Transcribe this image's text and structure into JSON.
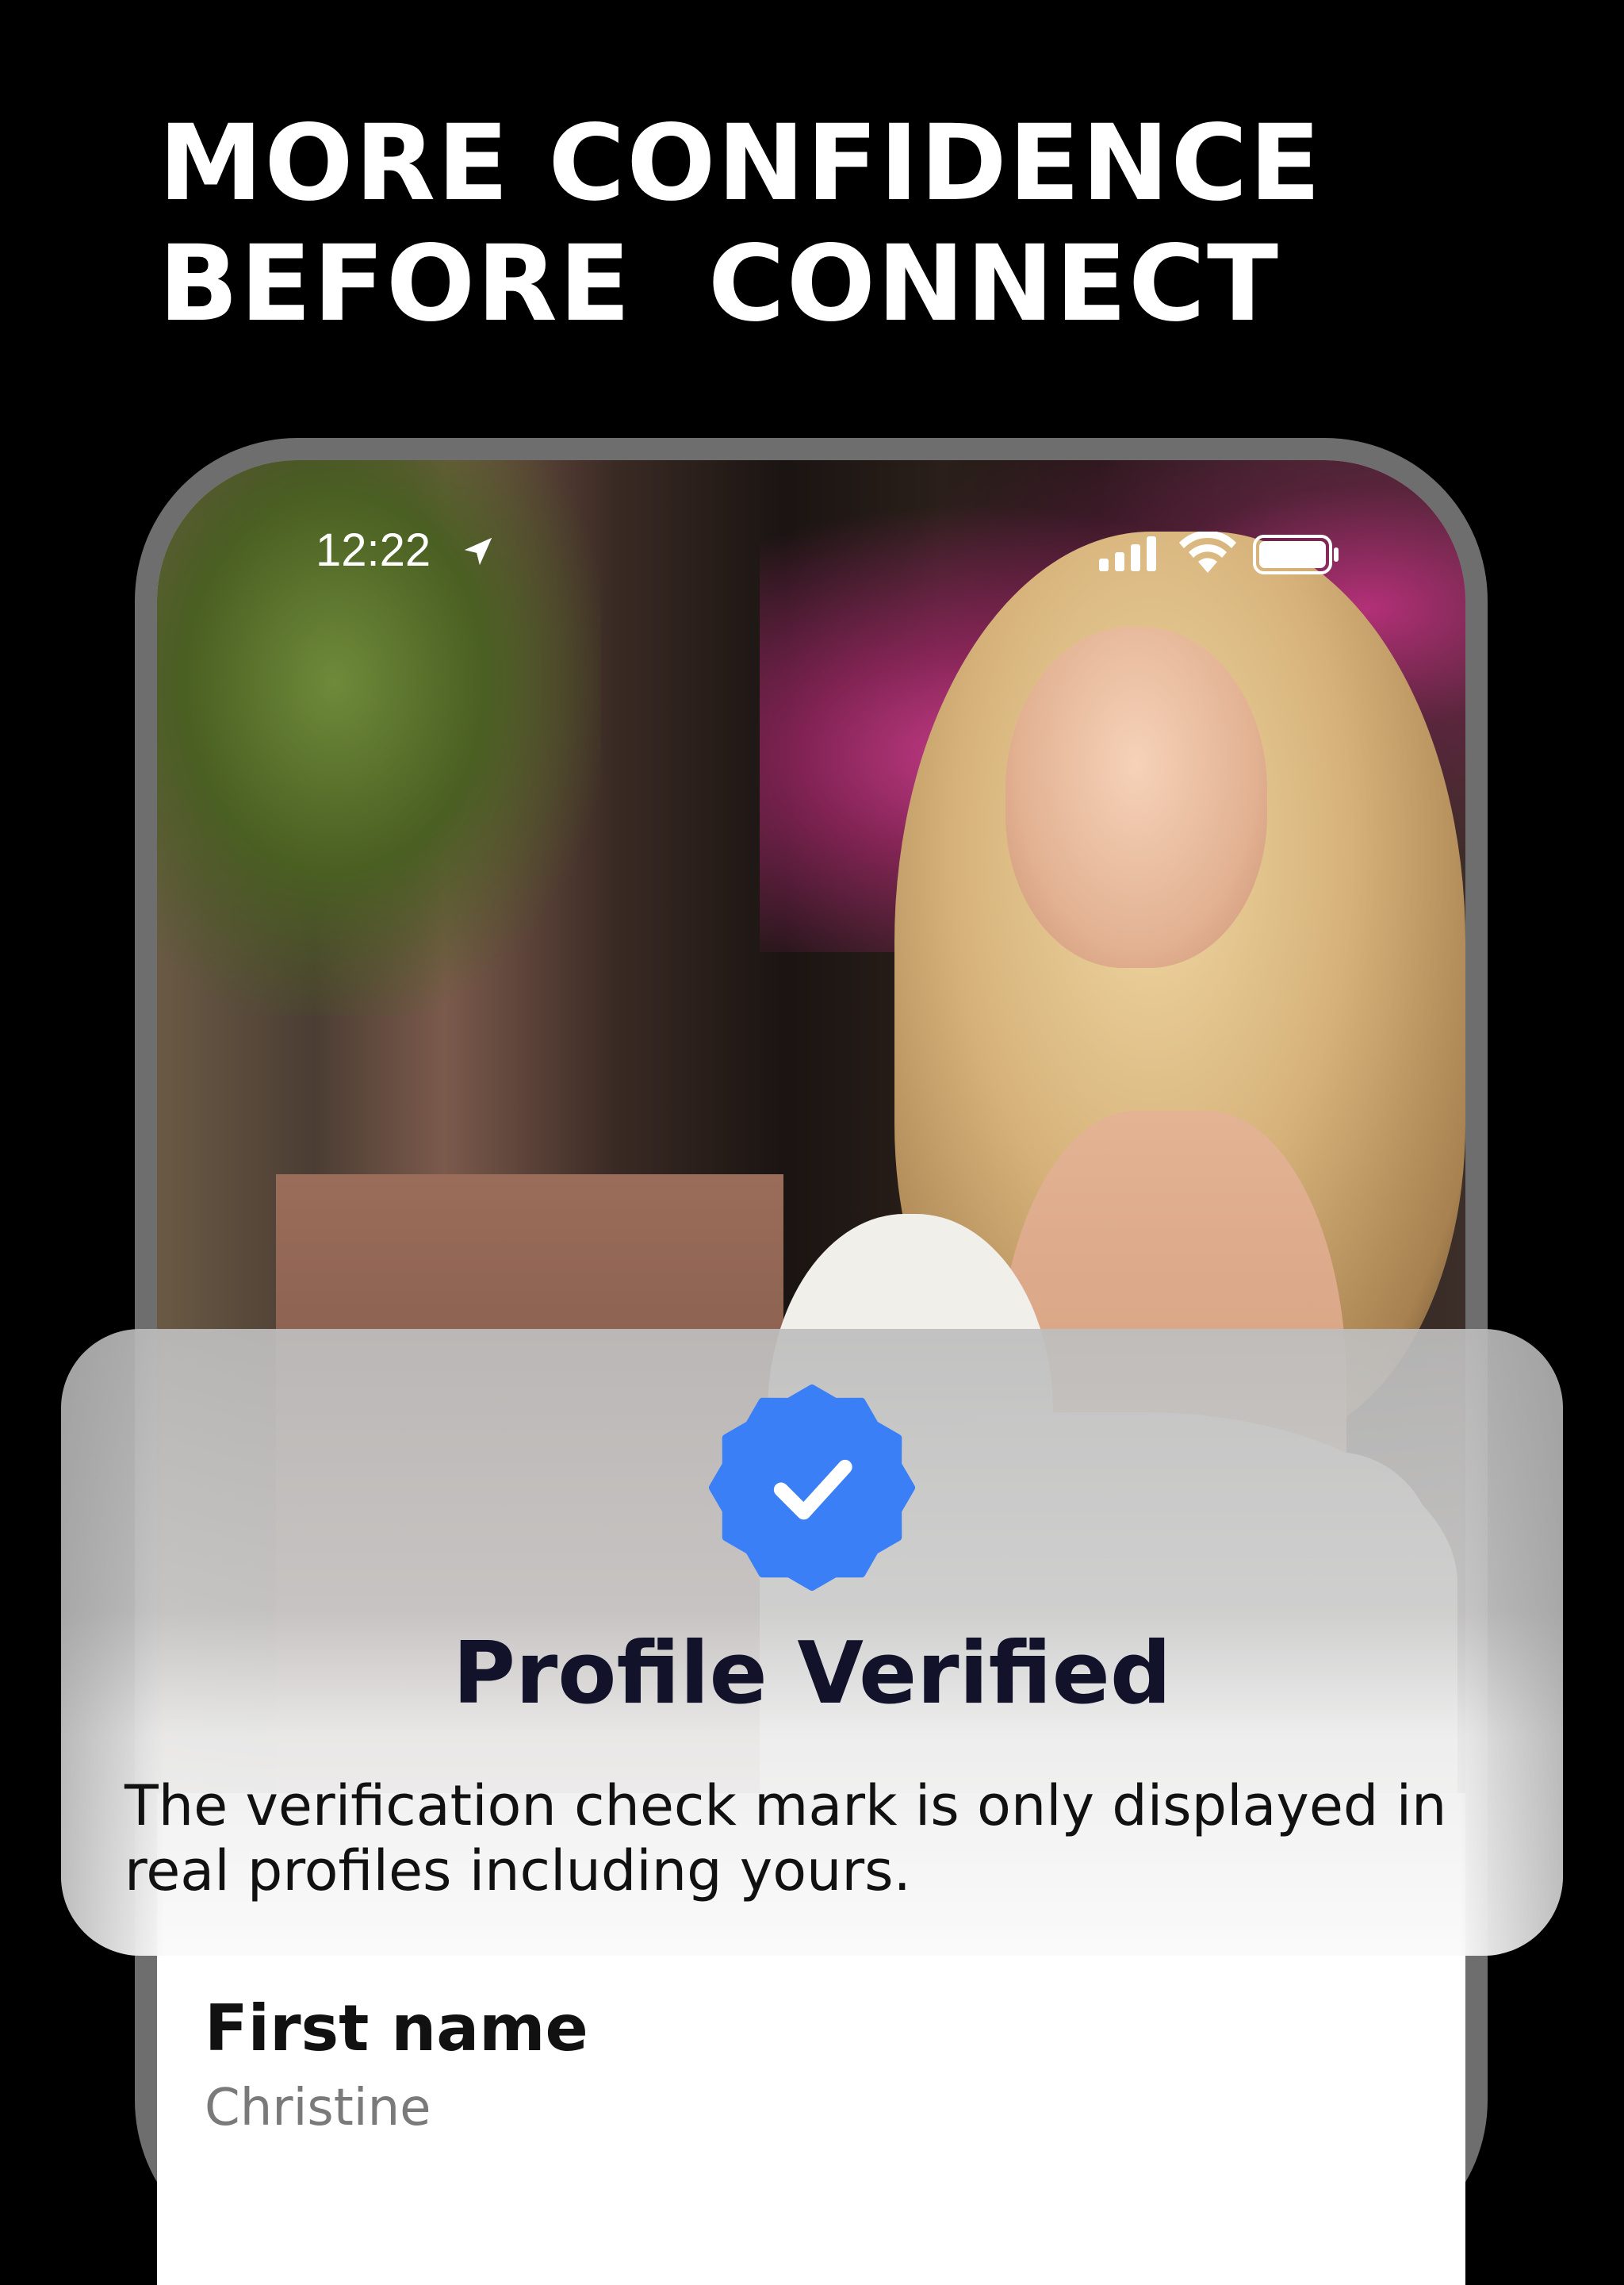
{
  "headline": "MORE CONFIDENCE\nBEFORE  CONNECT",
  "status_bar": {
    "time": "12:22",
    "icons": [
      "location-arrow-icon",
      "signal-icon",
      "wifi-icon",
      "battery-icon"
    ]
  },
  "verification_card": {
    "badge_icon": "verified-badge-icon",
    "badge_color": "#3a7ff6",
    "title": "Profile Verified",
    "description": "The verification check mark is only displayed in real profiles including yours."
  },
  "profile_fields": [
    {
      "label": "First name",
      "value": "Christine"
    }
  ]
}
